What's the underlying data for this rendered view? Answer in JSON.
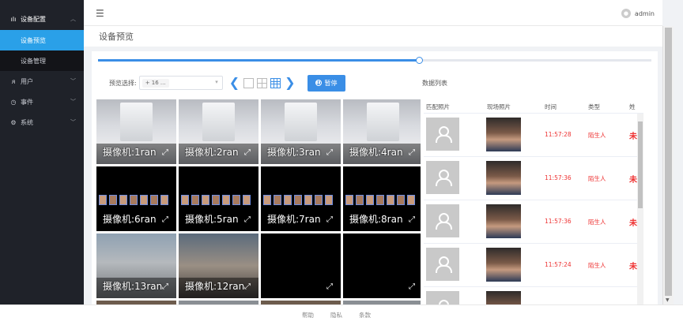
{
  "sidebar": {
    "menu": [
      {
        "label": "设备配置",
        "icon": "signal-icon",
        "expanded": true,
        "children": [
          {
            "label": "设备预览",
            "active": true
          },
          {
            "label": "设备管理",
            "active": false
          }
        ]
      },
      {
        "label": "用户",
        "icon": "user-icon"
      },
      {
        "label": "事件",
        "icon": "clock-icon"
      },
      {
        "label": "系统",
        "icon": "gear-icon"
      }
    ]
  },
  "header": {
    "user": "admin"
  },
  "page": {
    "title": "设备预览"
  },
  "slider": {
    "value_percent": 58
  },
  "toolbar": {
    "preview_label": "预览选择:",
    "selected_tag": "+ 16 ...",
    "pause_label": "暂停"
  },
  "cameras": [
    {
      "label": "摄像机:1ran",
      "scene": "corridor"
    },
    {
      "label": "摄像机:2ran",
      "scene": "corridor"
    },
    {
      "label": "摄像机:3ran",
      "scene": "corridor"
    },
    {
      "label": "摄像机:4ran",
      "scene": "corridor"
    },
    {
      "label": "摄像机:6ran",
      "scene": "faces"
    },
    {
      "label": "摄像机:5ran",
      "scene": "faces"
    },
    {
      "label": "摄像机:7ran",
      "scene": "faces"
    },
    {
      "label": "摄像机:8ran",
      "scene": "faces"
    },
    {
      "label": "摄像机:13ran",
      "scene": "outdoor"
    },
    {
      "label": "摄像机:12ran",
      "scene": "outdoor2"
    },
    {
      "label": "",
      "scene": "black"
    },
    {
      "label": "",
      "scene": "black"
    }
  ],
  "data_list": {
    "title": "数据列表",
    "columns": [
      "匹配照片",
      "现场照片",
      "时间",
      "类型",
      "姓"
    ],
    "rows": [
      {
        "time": "11:57:28",
        "type": "陌生人",
        "name": "未"
      },
      {
        "time": "11:57:36",
        "type": "陌生人",
        "name": "未"
      },
      {
        "time": "11:57:36",
        "type": "陌生人",
        "name": "未"
      },
      {
        "time": "11:57:24",
        "type": "陌生人",
        "name": "未"
      },
      {
        "time": "",
        "type": "",
        "name": ""
      }
    ]
  },
  "footer": {
    "links": [
      "帮助",
      "隐私",
      "条款"
    ]
  },
  "colors": {
    "accent": "#2aa0e8",
    "primary": "#3a8ee6",
    "alert": "#e33",
    "sidebar_bg": "#1f2229"
  }
}
